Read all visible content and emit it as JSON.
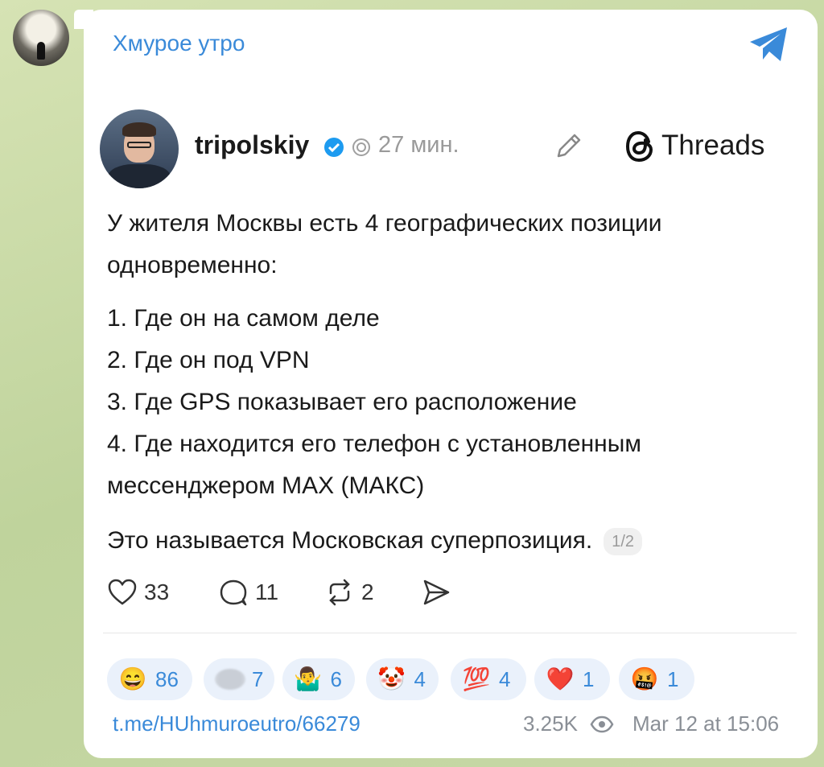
{
  "channel": {
    "name": "Хмурое утро"
  },
  "post": {
    "username": "tripolskiy",
    "time": "27 мин.",
    "source": "Threads",
    "intro": "У жителя Москвы есть 4 географических позиции одновременно:",
    "items": [
      "1. Где он на самом деле",
      "2. Где он под VPN",
      "3. Где GPS показывает его расположение",
      "4. Где находится его телефон с установленным мессенджером MAX (МАКС)"
    ],
    "ending": "Это называется Московская суперпозиция.",
    "page_badge": "1/2",
    "likes": "33",
    "replies": "11",
    "reposts": "2"
  },
  "reactions": [
    {
      "emoji": "😄",
      "count": "86"
    },
    {
      "emoji": "",
      "count": "7"
    },
    {
      "emoji": "🤷‍♂️",
      "count": "6"
    },
    {
      "emoji": "🤡",
      "count": "4"
    },
    {
      "emoji": "💯",
      "count": "4"
    },
    {
      "emoji": "❤️",
      "count": "1"
    },
    {
      "emoji": "🤬",
      "count": "1"
    }
  ],
  "footer": {
    "link": "t.me/HUhmuroeutro/66279",
    "views": "3.25K",
    "date": "Mar 12 at 15:06"
  },
  "icons": {
    "telegram": "telegram-plane-icon",
    "verified": "verified-badge-icon",
    "edit": "pencil-icon",
    "eye": "eye-icon"
  },
  "colors": {
    "accent": "#3a8ad9",
    "bubble": "#ffffff",
    "reaction_bg": "#eaf1fb"
  }
}
